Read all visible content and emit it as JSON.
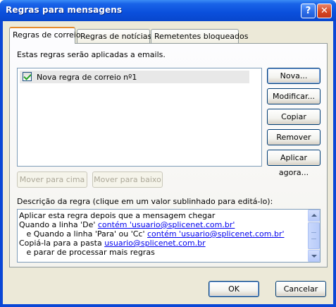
{
  "window": {
    "title": "Regras para mensagens",
    "help_glyph": "?",
    "close_glyph": "✕"
  },
  "tabs": [
    {
      "label": "Regras de correio",
      "active": true
    },
    {
      "label": "Regras de notícias",
      "active": false
    },
    {
      "label": "Remetentes bloqueados",
      "active": false
    }
  ],
  "rules_tab": {
    "intro": "Estas regras serão aplicadas a emails.",
    "rules": [
      {
        "name": "Nova regra de correio nº1",
        "checked": true
      }
    ],
    "buttons": {
      "new": "Nova...",
      "modify": "Modificar...",
      "copy": "Copiar",
      "remove": "Remover",
      "apply_now": "Aplicar agora...",
      "move_up": "Mover para cima",
      "move_down": "Mover para baixo"
    },
    "description_label": "Descrição da regra (clique em um valor sublinhado para editá-lo):",
    "description": {
      "line1": "Aplicar esta regra depois que a mensagem chegar",
      "line2_prefix": "Quando a linha 'De' ",
      "line2_link": "contém 'usuario@splicenet.com.br'",
      "line3_prefix": "   e Quando a linha 'Para' ou 'Cc' ",
      "line3_link": "contém 'usuario@splicenet.com.br'",
      "line4_prefix": "Copiá-la para a pasta ",
      "line4_link": "usuario@splicenet.com.br",
      "line5": "   e parar de processar mais regras"
    }
  },
  "footer": {
    "ok": "OK",
    "cancel": "Cancelar"
  },
  "colors": {
    "titlebar": "#0a4fdc",
    "dialog_bg": "#ece9d8",
    "active_tab_accent": "#e68b2c",
    "link": "#0000ee"
  }
}
